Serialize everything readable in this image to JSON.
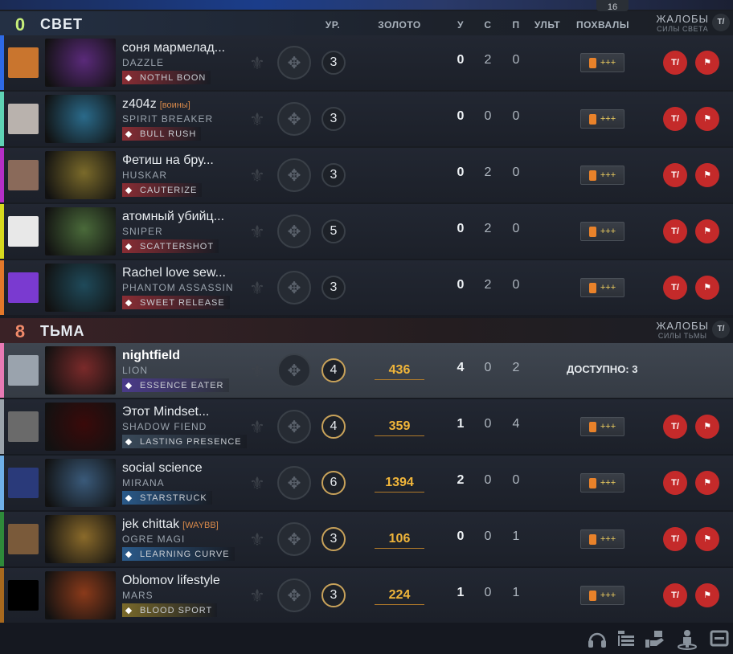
{
  "top_badge": "16",
  "columns": {
    "level": "УР.",
    "gold": "ЗОЛОТО",
    "kills": "У",
    "deaths": "С",
    "assists": "П",
    "ult": "УЛЬТ",
    "praise": "ПОХВАЛЫ"
  },
  "radiant": {
    "score": "0",
    "name": "СВЕТ",
    "complaints_title": "ЖАЛОБЫ",
    "complaints_sub": "СИЛЫ СВЕТА",
    "complaints_btn": "T/",
    "players": [
      {
        "name": "соня мармелад...",
        "tag": "",
        "hero": "DAZZLE",
        "facet": "NOTHL BOON",
        "level": "3",
        "gold": "",
        "k": "0",
        "d": "2",
        "a": "0",
        "praise": "+++",
        "bar": "#2e6ae6",
        "facet_color": "#8a2d34",
        "avatar": "#c9752e",
        "hero_bg": "#5a2a7a"
      },
      {
        "name": "z404z",
        "tag": "[воины]",
        "hero": "SPIRIT BREAKER",
        "facet": "BULL RUSH",
        "level": "3",
        "gold": "",
        "k": "0",
        "d": "0",
        "a": "0",
        "praise": "+++",
        "bar": "#5fd3b5",
        "facet_color": "#8a2d34",
        "avatar": "#b9b2ad",
        "hero_bg": "#2a6a8a"
      },
      {
        "name": "Фетиш на бру...",
        "tag": "",
        "hero": "HUSKAR",
        "facet": "CAUTERIZE",
        "level": "3",
        "gold": "",
        "k": "0",
        "d": "2",
        "a": "0",
        "praise": "+++",
        "bar": "#b42fc7",
        "facet_color": "#8a2d34",
        "avatar": "#8a6a5a",
        "hero_bg": "#7a6a2a"
      },
      {
        "name": "атомный убийц...",
        "tag": "",
        "hero": "SNIPER",
        "facet": "SCATTERSHOT",
        "level": "5",
        "gold": "",
        "k": "0",
        "d": "2",
        "a": "0",
        "praise": "+++",
        "bar": "#d7d91e",
        "facet_color": "#8a2d34",
        "avatar": "#e8e8e8",
        "hero_bg": "#4a6a3a"
      },
      {
        "name": "Rachel love sew...",
        "tag": "",
        "hero": "PHANTOM ASSASSIN",
        "facet": "SWEET RELEASE",
        "level": "3",
        "gold": "",
        "k": "0",
        "d": "2",
        "a": "0",
        "praise": "+++",
        "bar": "#e2782a",
        "facet_color": "#8a2d34",
        "avatar": "#7a3ad0",
        "hero_bg": "#1f4a5a"
      }
    ]
  },
  "dire": {
    "score": "8",
    "name": "ТЬМА",
    "complaints_title": "ЖАЛОБЫ",
    "complaints_sub": "СИЛЫ ТЬМЫ",
    "complaints_btn": "T/",
    "players": [
      {
        "name": "nightfield",
        "tag": "",
        "hero": "LION",
        "facet": "ESSENCE EATER",
        "level": "4",
        "gold": "436",
        "k": "4",
        "d": "0",
        "a": "2",
        "praise": "",
        "available": "ДОСТУПНО: 3",
        "bar": "#e87ab4",
        "facet_color": "#4a3a8a",
        "avatar": "#9aa3ad",
        "hero_bg": "#7a2a2a",
        "self": true
      },
      {
        "name": "Этот Mindset...",
        "tag": "",
        "hero": "SHADOW FIEND",
        "facet": "LASTING PRESENCE",
        "level": "4",
        "gold": "359",
        "k": "1",
        "d": "0",
        "a": "4",
        "praise": "+++",
        "bar": "#9ba3ab",
        "facet_color": "#3a4a5a",
        "avatar": "#6a6a6a",
        "hero_bg": "#3a0a0a"
      },
      {
        "name": "social science",
        "tag": "",
        "hero": "MIRANA",
        "facet": "STARSTRUCK",
        "level": "6",
        "gold": "1394",
        "k": "2",
        "d": "0",
        "a": "0",
        "praise": "+++",
        "bar": "#6fb0e8",
        "facet_color": "#2a5a8a",
        "avatar": "#2a3a7a",
        "hero_bg": "#3a5a7a"
      },
      {
        "name": "jek chittak",
        "tag": "[WAYBB]",
        "hero": "OGRE MAGI",
        "facet": "LEARNING CURVE",
        "level": "3",
        "gold": "106",
        "k": "0",
        "d": "0",
        "a": "1",
        "praise": "+++",
        "bar": "#2e8a3a",
        "facet_color": "#2a5a8a",
        "avatar": "#7a5a3a",
        "hero_bg": "#8a6a2a"
      },
      {
        "name": "Oblomov lifestyle",
        "tag": "",
        "hero": "MARS",
        "facet": "BLOOD SPORT",
        "level": "3",
        "gold": "224",
        "k": "1",
        "d": "0",
        "a": "1",
        "praise": "+++",
        "bar": "#a8691e",
        "facet_color": "#7a6a2a",
        "avatar": "#000000",
        "hero_bg": "#8a3a1a"
      }
    ]
  },
  "toolbar": {
    "icons": [
      "headset-icon",
      "scoreboard-icon",
      "hand-icon",
      "coach-icon",
      "screen-icon"
    ]
  }
}
